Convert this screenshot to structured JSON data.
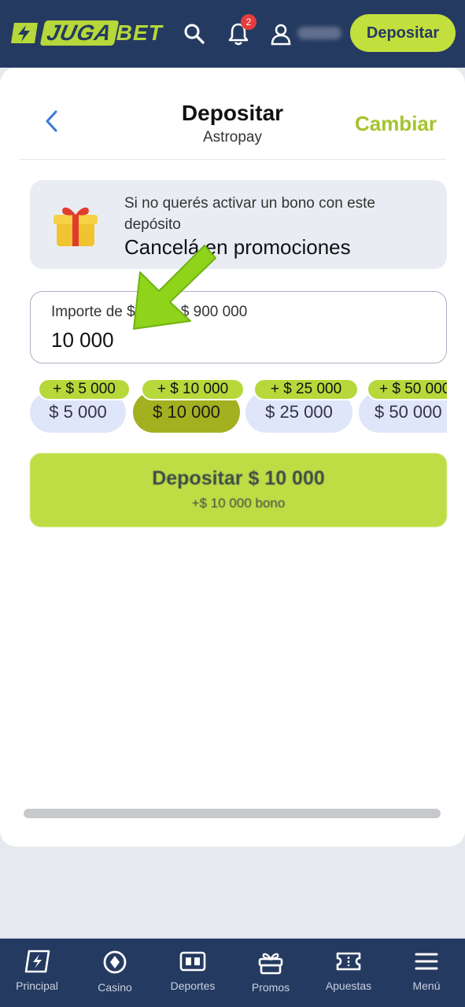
{
  "header": {
    "logo_a": "JUGA",
    "logo_b": "BET",
    "notification_count": "2",
    "deposit_button": "Depositar"
  },
  "page": {
    "title": "Depositar",
    "subtitle": "Astropay",
    "change_label": "Cambiar"
  },
  "promo": {
    "text": "Si no querés activar un bono con este depósito",
    "action": "Cancelá en promociones"
  },
  "amount": {
    "label": "Importe de $ 200 a $ 900 000",
    "value": "10 000"
  },
  "presets": [
    {
      "label": "$ 5 000",
      "bonus": "+ $ 5 000"
    },
    {
      "label": "$ 10 000",
      "bonus": "+ $ 10 000",
      "selected": true
    },
    {
      "label": "$ 25 000",
      "bonus": "+ $ 25 000"
    },
    {
      "label": "$ 50 000",
      "bonus": "+ $ 50 000"
    }
  ],
  "submit": {
    "label": "Depositar $ 10 000",
    "bonus": "+$ 10 000 bono"
  },
  "bottom_nav": [
    {
      "label": "Principal",
      "icon": "lightning-icon"
    },
    {
      "label": "Casino",
      "icon": "chip-icon"
    },
    {
      "label": "Deportes",
      "icon": "scoreboard-icon"
    },
    {
      "label": "Promos",
      "icon": "gift-icon"
    },
    {
      "label": "Apuestas",
      "icon": "ticket-icon"
    },
    {
      "label": "Menú",
      "icon": "menu-icon"
    }
  ],
  "colors": {
    "brand_dark": "#253a60",
    "brand_lime": "#c3df3d",
    "selected_chip": "#a3b01f",
    "notification_red": "#e53d3d"
  }
}
